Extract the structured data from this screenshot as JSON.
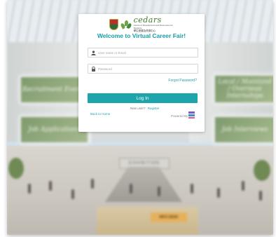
{
  "logo": {
    "name": "cedars",
    "subtitle": "Centre of Development and Resources for Students",
    "chinese": "學生發展及資源中心"
  },
  "login": {
    "title": "Welcome to Virtual Career Fair!",
    "username_placeholder": "User name or Email",
    "password_placeholder": "Password",
    "forgot_label": "Forgot Password?",
    "login_label": "Log In",
    "new_user_label": "New user?",
    "register_label": "Register",
    "back_label": "Back to Home",
    "powered_label": "Powered By"
  },
  "scene": {
    "boards": [
      "Recruitment Events",
      "Local / Mainland / Overseas Internships",
      "Job Applications",
      "Job Interviews"
    ],
    "exhibition_label": "EXHIBITION",
    "info_desk_label": "INFO DESK"
  },
  "colors": {
    "accent": "#1ea5ac",
    "title": "#179da6"
  },
  "icons": [
    "user-icon",
    "lock-icon"
  ]
}
